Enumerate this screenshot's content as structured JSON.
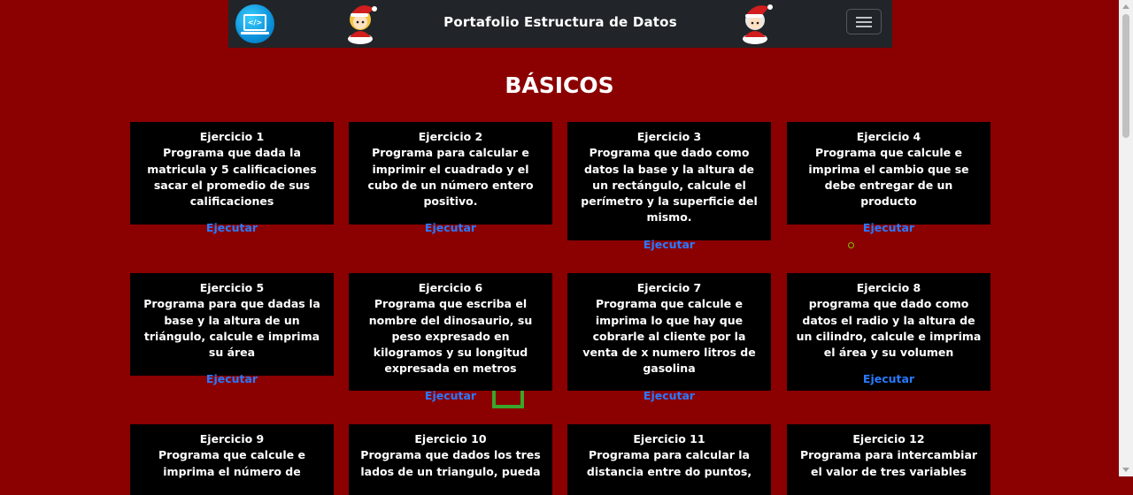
{
  "navbar": {
    "title": "Portafolio Estructura de Datos",
    "logo_icon": "laptop-code-icon",
    "menu_icon": "hamburger-menu-icon"
  },
  "section": {
    "title": "BÁSICOS"
  },
  "cards": [
    {
      "title": "Ejercicio 1",
      "desc": "Programa que dada la matricula y 5 calificaciones sacar el promedio de sus calificaciones",
      "action": "Ejecutar"
    },
    {
      "title": "Ejercicio 2",
      "desc": "Programa para calcular e imprimir el cuadrado y el cubo de un número entero positivo.",
      "action": "Ejecutar"
    },
    {
      "title": "Ejercicio 3",
      "desc": "Programa que dado como datos la base y la altura de un rectángulo, calcule el perímetro y la superficie del mismo.",
      "action": "Ejecutar"
    },
    {
      "title": "Ejercicio 4",
      "desc": "Programa que calcule e imprima el cambio que se debe entregar de un producto",
      "action": "Ejecutar"
    },
    {
      "title": "Ejercicio 5",
      "desc": "Programa para que dadas la base y la altura de un triángulo, calcule e imprima su área",
      "action": "Ejecutar"
    },
    {
      "title": "Ejercicio 6",
      "desc": "Programa que escriba el nombre del dinosaurio, su peso expresado en kilogramos y su longitud expresada en metros",
      "action": "Ejecutar"
    },
    {
      "title": "Ejercicio 7",
      "desc": "Programa que calcule e imprima lo que hay que cobrarle al cliente por la venta de x numero litros de gasolina",
      "action": "Ejecutar"
    },
    {
      "title": "Ejercicio 8",
      "desc": "programa que dado como datos el radio y la altura de un cilindro, calcule e imprima el área y su volumen",
      "action": "Ejecutar"
    },
    {
      "title": "Ejercicio 9",
      "desc": "Programa que calcule e imprima el número de",
      "action": ""
    },
    {
      "title": "Ejercicio 10",
      "desc": "Programa que dados los tres lados de un triangulo, pueda",
      "action": ""
    },
    {
      "title": "Ejercicio 11",
      "desc": "Programa para calcular la distancia entre do puntos,",
      "action": ""
    },
    {
      "title": "Ejercicio 12",
      "desc": "Programa para intercambiar el valor de tres variables",
      "action": ""
    }
  ]
}
